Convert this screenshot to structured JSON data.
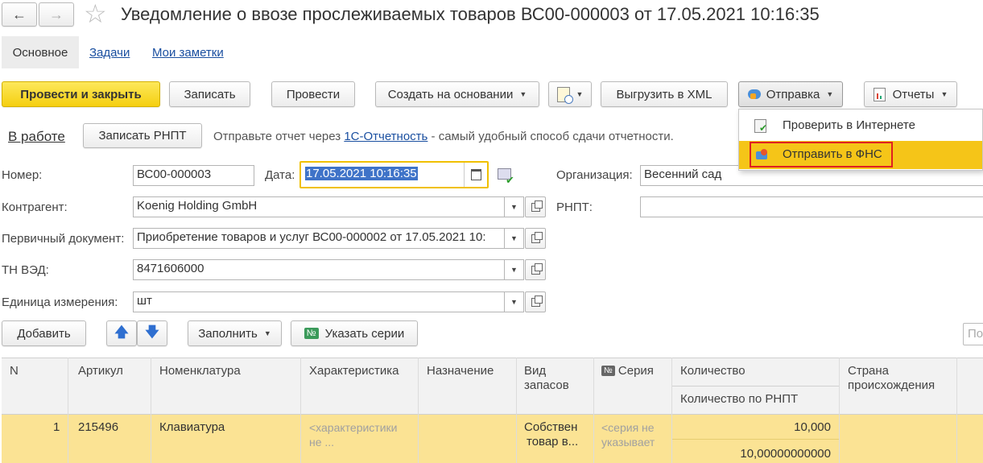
{
  "window": {
    "title": "Уведомление о ввозе прослеживаемых товаров ВС00-000003 от 17.05.2021 10:16:35"
  },
  "nav": {
    "back": "←",
    "forward": "→",
    "star": "☆"
  },
  "tabs": [
    {
      "label": "Основное"
    },
    {
      "label": "Задачи"
    },
    {
      "label": "Мои заметки"
    }
  ],
  "toolbar": {
    "post_close": "Провести и закрыть",
    "save": "Записать",
    "post": "Провести",
    "create_based": "Создать на основании",
    "export_xml": "Выгрузить в XML",
    "send": "Отправка",
    "reports": "Отчеты"
  },
  "send_menu": {
    "items": [
      {
        "label": "Проверить в Интернете"
      },
      {
        "label": "Отправить в ФНС"
      }
    ]
  },
  "status": {
    "state": "В работе",
    "write_rnpt": "Записать РНПТ",
    "hint_prefix": "Отправьте отчет через ",
    "hint_link": "1С-Отчетность",
    "hint_suffix": " - самый удобный способ сдачи отчетности."
  },
  "form": {
    "number_label": "Номер:",
    "number": "ВС00-000003",
    "date_label": "Дата:",
    "date": "17.05.2021 10:16:35",
    "org_label": "Организация:",
    "org": "Весенний сад",
    "counterparty_label": "Контрагент:",
    "counterparty": "Koenig Holding GmbH",
    "rnpt_label": "РНПТ:",
    "rnpt": "",
    "primary_doc_label": "Первичный документ:",
    "primary_doc": "Приобретение товаров и услуг ВС00-000002 от 17.05.2021 10:",
    "tnved_label": "ТН ВЭД:",
    "tnved": "8471606000",
    "unit_label": "Единица измерения:",
    "unit": "шт"
  },
  "table_toolbar": {
    "add": "Добавить",
    "fill": "Заполнить",
    "series": "Указать серии",
    "search_placeholder": "По"
  },
  "table": {
    "headers": {
      "n": "N",
      "article": "Артикул",
      "nomenclature": "Номенклатура",
      "characteristic": "Характеристика",
      "purpose": "Назначение",
      "stock_type_1": "Вид",
      "stock_type_2": "запасов",
      "series": "Серия",
      "quantity": "Количество",
      "quantity_rnpt": "Количество по РНПТ",
      "country_1": "Страна",
      "country_2": "происхождения"
    },
    "rows": [
      {
        "n": "1",
        "article": "215496",
        "nomenclature": "Клавиатура",
        "characteristic_1": "<характеристики",
        "characteristic_2": "не ...",
        "purpose": "",
        "stock_1": "Собствен",
        "stock_2": "товар в...",
        "series_1": "<серия не",
        "series_2": "указывает",
        "quantity": "10,000",
        "quantity_rnpt": "10,00000000000"
      }
    ]
  },
  "colors": {
    "primary": "#f5cf10",
    "highlight": "#fbe394",
    "link": "#1a4fa0",
    "menu_selected": "#f5c518"
  }
}
